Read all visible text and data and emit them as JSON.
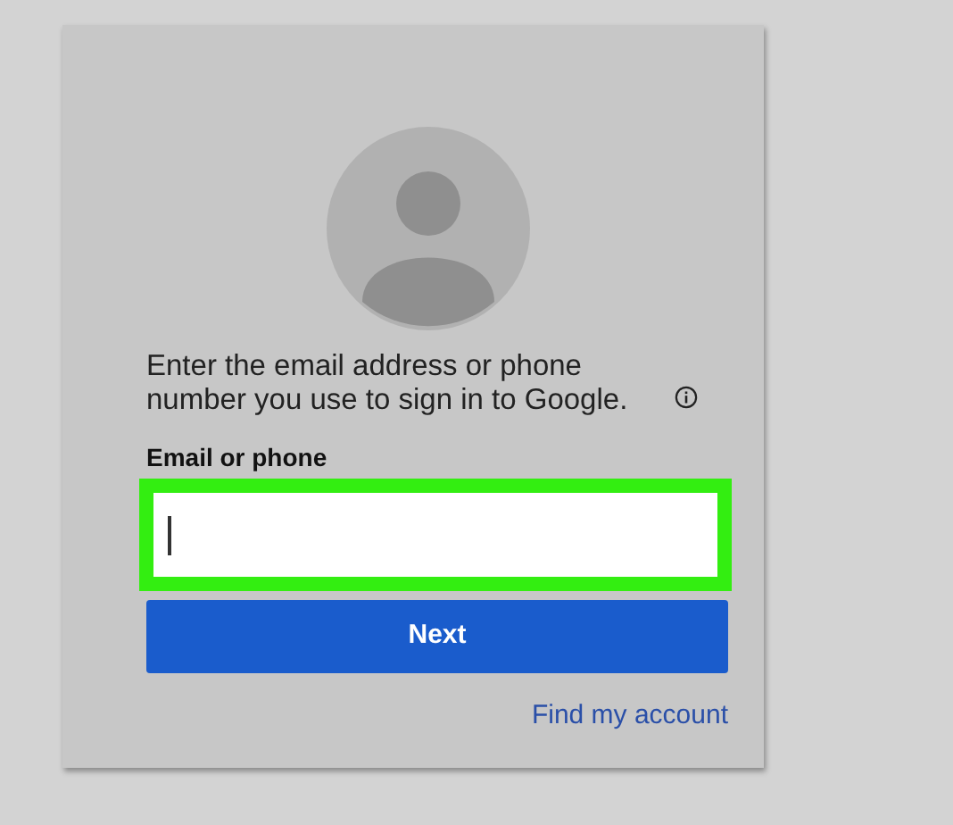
{
  "prompt": "Enter the email address or phone number you use to sign in to Google.",
  "field": {
    "label": "Email or phone",
    "highlighted": true,
    "focused": true
  },
  "next_button": "Next",
  "link": "Find my account"
}
